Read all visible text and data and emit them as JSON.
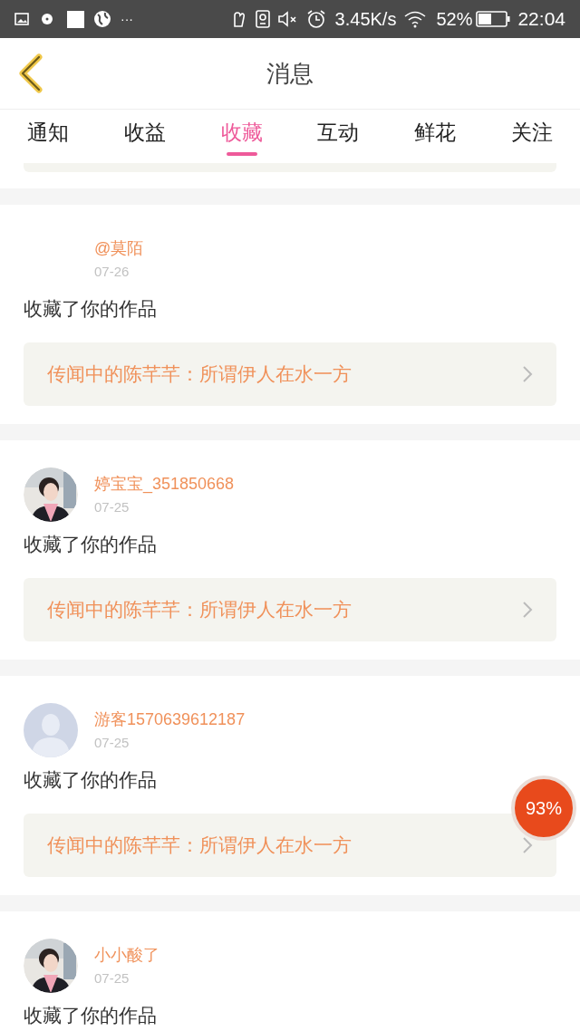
{
  "status_bar": {
    "more": "···",
    "speed": "3.45K/s",
    "battery": "52%",
    "time": "22:04"
  },
  "header": {
    "title": "消息"
  },
  "tabs": [
    {
      "label": "通知",
      "selected": false
    },
    {
      "label": "收益",
      "selected": false
    },
    {
      "label": "收藏",
      "selected": true
    },
    {
      "label": "互动",
      "selected": false
    },
    {
      "label": "鲜花",
      "selected": false
    },
    {
      "label": "关注",
      "selected": false
    }
  ],
  "messages": [
    {
      "kind": "none",
      "user": "@莫陌",
      "date": "07-26",
      "text": "收藏了你的作品",
      "work": "传闻中的陈芊芊：所谓伊人在水一方"
    },
    {
      "kind": "picture",
      "user": "婷宝宝_351850668",
      "date": "07-25",
      "text": "收藏了你的作品",
      "work": "传闻中的陈芊芊：所谓伊人在水一方"
    },
    {
      "kind": "default",
      "user": "游客1570639612187",
      "date": "07-25",
      "text": "收藏了你的作品",
      "work": "传闻中的陈芊芊：所谓伊人在水一方"
    },
    {
      "kind": "picture",
      "user": "小小酸了",
      "date": "07-25",
      "text": "收藏了你的作品"
    }
  ],
  "floating_badge": "93%"
}
